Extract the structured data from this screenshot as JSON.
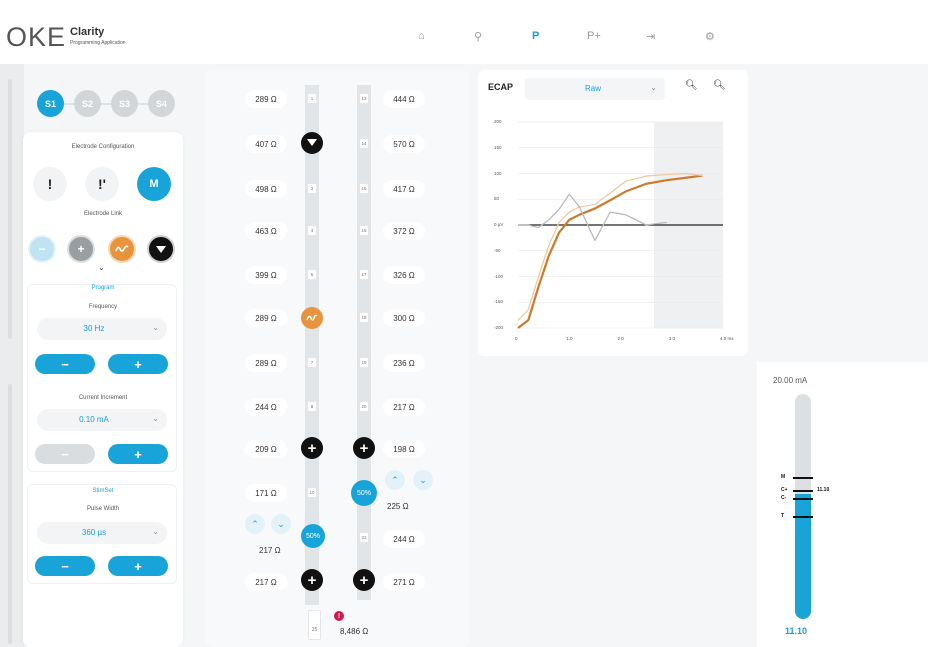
{
  "app": {
    "logo_mark": "OKE",
    "logo_title": "Clarity",
    "logo_subtitle": "Programming Application"
  },
  "nav": [
    {
      "id": "home",
      "glyph": "⌂",
      "active": false
    },
    {
      "id": "patient",
      "glyph": "⚲",
      "active": false
    },
    {
      "id": "program",
      "glyph": "P",
      "active": true
    },
    {
      "id": "program-plus",
      "glyph": "P+",
      "active": false
    },
    {
      "id": "export",
      "glyph": "⇥",
      "active": false
    },
    {
      "id": "settings",
      "glyph": "⚙",
      "active": false
    }
  ],
  "stimsets": [
    "S1",
    "S2",
    "S3",
    "S4"
  ],
  "electrode_configuration": {
    "label": "Electrode Configuration",
    "buttons": [
      "!",
      "!'",
      "M"
    ],
    "link_label": "Electrode Link"
  },
  "program": {
    "section_title": "Program",
    "frequency_label": "Frequency",
    "frequency_value": "30 Hz",
    "current_increment_label": "Current Increment",
    "current_increment_value": "0.10 mA",
    "minus": "−",
    "plus": "+"
  },
  "stimset": {
    "section_title": "StimSet",
    "pulse_width_label": "Pulse Width",
    "pulse_width_value": "360 µs"
  },
  "electrodes": {
    "left_numbers": [
      "1",
      "3",
      "4",
      "5",
      "7",
      "8",
      "10"
    ],
    "left_impedances": [
      "289 Ω",
      "407 Ω",
      "498 Ω",
      "463 Ω",
      "399 Ω",
      "289 Ω",
      "289 Ω",
      "244 Ω",
      "209 Ω",
      "171 Ω",
      "217 Ω",
      "217 Ω"
    ],
    "right_numbers": [
      "13",
      "14",
      "15",
      "16",
      "17",
      "18",
      "19",
      "20",
      "23"
    ],
    "right_impedances": [
      "444 Ω",
      "570 Ω",
      "417 Ω",
      "372 Ω",
      "326 Ω",
      "300 Ω",
      "236 Ω",
      "217 Ω",
      "198 Ω",
      "225 Ω",
      "244 Ω",
      "271 Ω"
    ],
    "left_percent": "50%",
    "right_percent": "50%",
    "bottom_number": "25",
    "bottom_impedance": "8,486 Ω",
    "warning": "!"
  },
  "ecap": {
    "title": "ECAP",
    "mode": "Raw",
    "y_ticks": [
      "200",
      "150",
      "100",
      "50",
      "0 µV",
      "-50",
      "-100",
      "-150",
      "-200"
    ],
    "x_ticks": [
      "0",
      "1.0",
      "2.0",
      "3.0",
      "4.0 ms"
    ]
  },
  "chart_data": {
    "type": "line",
    "title": "",
    "xlabel": "",
    "ylabel": "",
    "xlim": [
      0,
      4.0
    ],
    "ylim": [
      -200,
      200
    ],
    "series": [
      {
        "color": "#cc7a2c",
        "x": [
          0.0,
          0.2,
          0.4,
          0.6,
          0.8,
          1.0,
          1.2,
          1.5,
          1.8,
          2.1,
          2.5,
          2.9,
          3.3,
          3.6
        ],
        "y": [
          -200,
          -185,
          -120,
          -60,
          -15,
          10,
          20,
          32,
          48,
          65,
          80,
          87,
          92,
          96
        ]
      },
      {
        "color": "#f0c9a3",
        "x": [
          0.0,
          0.2,
          0.4,
          0.6,
          0.8,
          1.0,
          1.2,
          1.5,
          1.8,
          2.1,
          2.5,
          2.9,
          3.3,
          3.6
        ],
        "y": [
          -185,
          -165,
          -100,
          -40,
          5,
          25,
          35,
          40,
          62,
          85,
          95,
          98,
          100,
          96
        ]
      },
      {
        "color": "#b9b9b9",
        "x": [
          0.0,
          0.2,
          0.4,
          0.6,
          0.8,
          1.0,
          1.2,
          1.5,
          1.8,
          2.1,
          2.5,
          2.9
        ],
        "y": [
          0,
          0,
          -5,
          10,
          30,
          60,
          35,
          -30,
          25,
          20,
          0,
          5
        ]
      }
    ],
    "baseline": 0
  },
  "current": {
    "max_label": "20.00 mA",
    "value_label": "11.10",
    "level_fraction": 0.555,
    "marks": [
      {
        "label": "M",
        "fraction": 0.63
      },
      {
        "label": "C+",
        "fraction": 0.575
      },
      {
        "label": "C-",
        "fraction": 0.54
      },
      {
        "label": "T",
        "fraction": 0.46
      }
    ],
    "marker_value": "11.10"
  },
  "colors": {
    "accent": "#18a4d8",
    "orange": "#e8943e"
  }
}
